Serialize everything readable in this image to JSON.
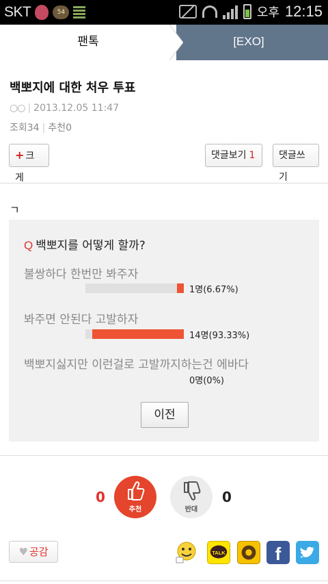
{
  "status_bar": {
    "carrier": "SKT",
    "notification_badge": "54",
    "ampm": "오후",
    "time": "12:15"
  },
  "tabs": {
    "left_label": "팬톡",
    "right_label": "[EXO]"
  },
  "post": {
    "title": "백뽀지에 대한 처우 투표",
    "author": "○○",
    "date": "2013.12.05 11:47",
    "views_label": "조회",
    "views": "34",
    "recommend_label": "추천",
    "recommend": "0",
    "body_text": "ㄱ"
  },
  "actions": {
    "font_size_label": "크게",
    "view_comments_label": "댓글보기",
    "comment_count": "1",
    "write_comment_label": "댓글쓰기"
  },
  "poll": {
    "q_marker": "Q",
    "question": "백뽀지를 어떻게 할까?",
    "options": [
      {
        "label": "불쌍하다 한번만 봐주자",
        "result": "1명(6.67%)",
        "fraction": 0.0667
      },
      {
        "label": "봐주면 안된다 고발하자",
        "result": "14명(93.33%)",
        "fraction": 0.9333
      },
      {
        "label": "백뽀지싫지만 이런걸로 고발까지하는건 에바다",
        "result": "0명(0%)",
        "fraction": 0
      }
    ],
    "prev_label": "이전"
  },
  "votes": {
    "up_count": "0",
    "up_label": "추천",
    "down_label": "반대",
    "down_count": "0"
  },
  "share": {
    "like_label": "공감",
    "facebook_glyph": "f",
    "kakaotalk_label": "TALK"
  },
  "colors": {
    "accent_red": "#e4322b",
    "bar_fill": "#ee5434",
    "tab_active": "#61758b"
  }
}
